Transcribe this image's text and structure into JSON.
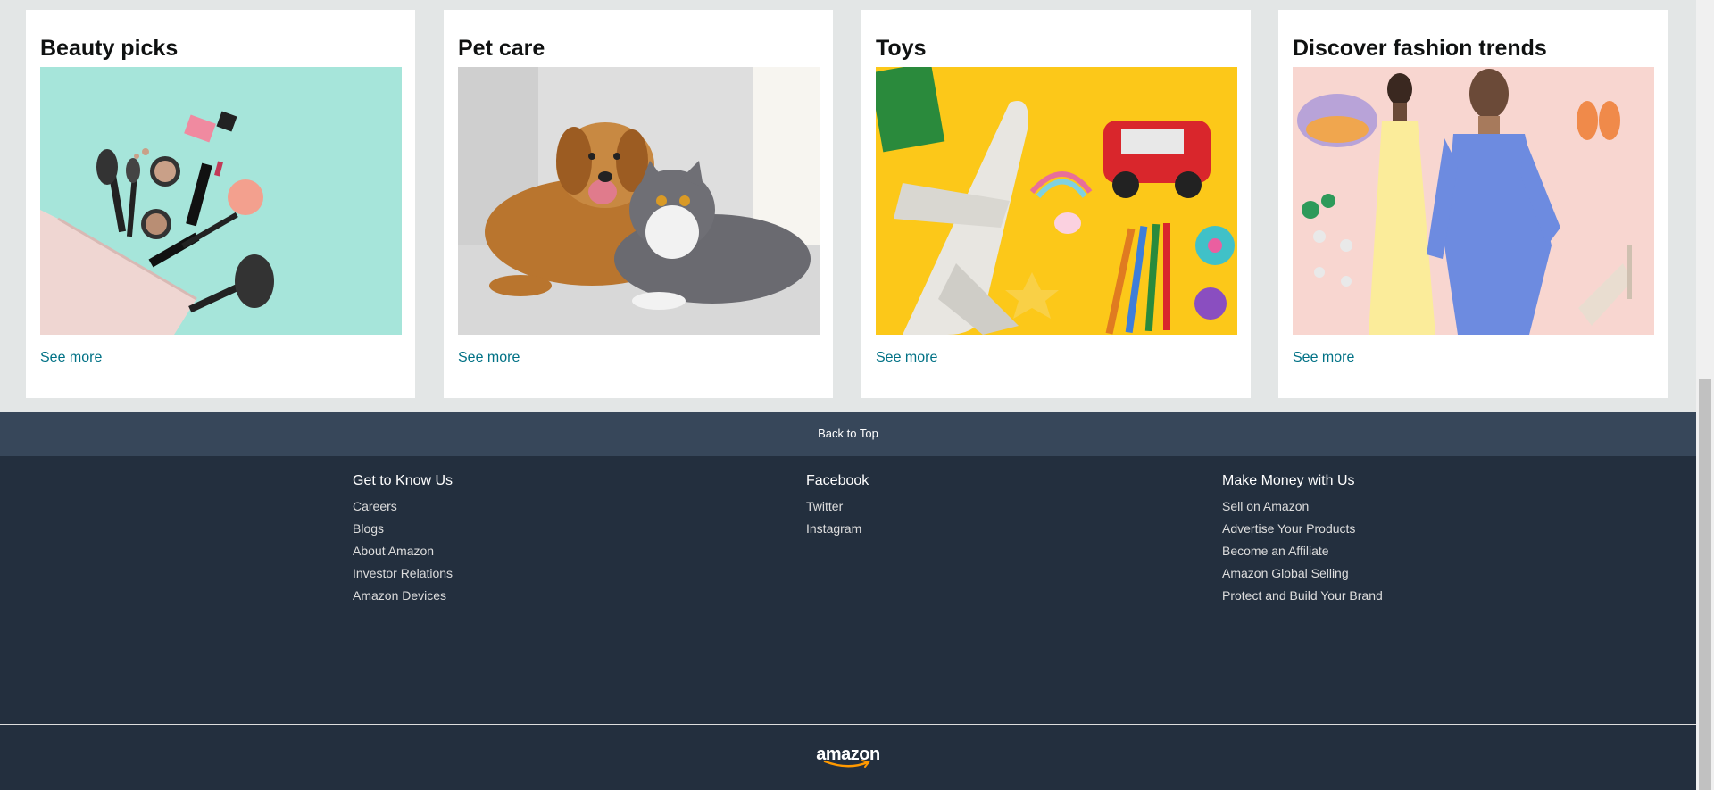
{
  "cards": [
    {
      "title": "Beauty picks",
      "link": "See more",
      "image": "makeup-products-photo"
    },
    {
      "title": "Pet care",
      "link": "See more",
      "image": "dog-and-cat-photo"
    },
    {
      "title": "Toys",
      "link": "See more",
      "image": "toys-photo"
    },
    {
      "title": "Discover fashion trends",
      "link": "See more",
      "image": "fashion-models-photo"
    }
  ],
  "footer": {
    "back_to_top": "Back to Top",
    "columns": [
      {
        "heading": "Get to Know Us",
        "links": [
          "Careers",
          "Blogs",
          "About Amazon",
          "Investor Relations",
          "Amazon Devices"
        ]
      },
      {
        "heading": "Facebook",
        "links": [
          "Twitter",
          "Instagram"
        ]
      },
      {
        "heading": "Make Money with Us",
        "links": [
          "Sell on Amazon",
          "Advertise Your Products",
          "Become an Affiliate",
          "Amazon Global Selling",
          "Protect and Build Your Brand"
        ]
      }
    ],
    "logo_text": "amazon"
  },
  "colors": {
    "page_bg": "#e3e6e6",
    "link": "#007185",
    "back_to_top_bg": "#37475a",
    "footer_bg": "#232f3e",
    "logo_smile": "#ff9900"
  }
}
